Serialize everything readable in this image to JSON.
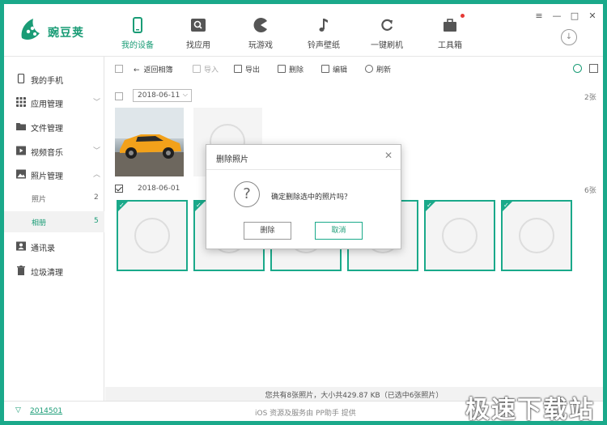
{
  "app": {
    "logo_text": "豌豆荚"
  },
  "nav": {
    "items": [
      {
        "label": "我的设备",
        "icon": "phone-icon"
      },
      {
        "label": "找应用",
        "icon": "search-box-icon"
      },
      {
        "label": "玩游戏",
        "icon": "pacman-icon"
      },
      {
        "label": "铃声壁纸",
        "icon": "music-note-icon"
      },
      {
        "label": "一键刷机",
        "icon": "refresh-icon"
      },
      {
        "label": "工具箱",
        "icon": "toolbox-icon"
      }
    ],
    "window_controls": [
      "≡",
      "—",
      "□",
      "✕"
    ]
  },
  "sidebar": {
    "items": [
      {
        "label": "我的手机",
        "icon": "phone-icon"
      },
      {
        "label": "应用管理",
        "icon": "grid-icon",
        "arrow": "﹀"
      },
      {
        "label": "文件管理",
        "icon": "folder-icon"
      },
      {
        "label": "视频音乐",
        "icon": "video-icon",
        "arrow": "﹀"
      },
      {
        "label": "照片管理",
        "icon": "image-icon",
        "arrow": "︿"
      },
      {
        "label": "通讯录",
        "icon": "contacts-icon"
      },
      {
        "label": "垃圾清理",
        "icon": "trash-icon"
      }
    ],
    "sub_items": [
      {
        "label": "照片",
        "count": "2"
      },
      {
        "label": "相册",
        "count": "5"
      }
    ]
  },
  "toolbar": {
    "back": "返回相簿",
    "import": "导入",
    "export": "导出",
    "delete": "删除",
    "edit": "编辑",
    "refresh": "刷新"
  },
  "groups": [
    {
      "date": "2018-06-11",
      "count": "2张"
    },
    {
      "date": "2018-06-01",
      "count": "6张"
    }
  ],
  "status_text": "您共有8张照片，大小共429.87 KB（已选中6张照片）",
  "footer": {
    "version": "2014501",
    "provider": "iOS 资源及服务由 PP助手 提供",
    "brand": "极速下载站"
  },
  "dialog": {
    "title": "删除照片",
    "close": "✕",
    "question_mark": "?",
    "message": "确定删除选中的照片吗？",
    "confirm": "删除",
    "cancel": "取消"
  },
  "colors": {
    "accent": "#1aa98a",
    "accent_text": "#1a9c76",
    "badge": "#e53935"
  }
}
